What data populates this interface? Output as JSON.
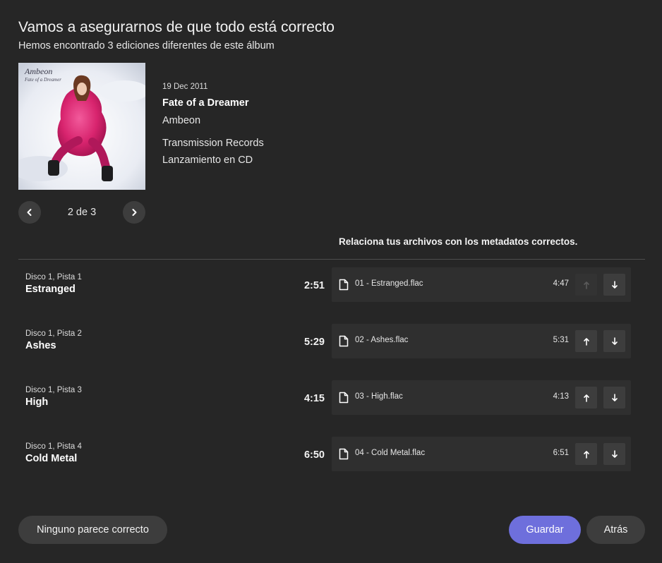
{
  "header": {
    "title": "Vamos a asegurarnos de que todo está correcto",
    "subtitle": "Hemos encontrado 3 ediciones diferentes de este álbum"
  },
  "edition": {
    "cover_text_artist": "Ambeon",
    "cover_text_album": "Fate of a Dreamer",
    "date": "19 Dec 2011",
    "album": "Fate of a Dreamer",
    "artist": "Ambeon",
    "label": "Transmission Records",
    "format": "Lanzamiento en CD"
  },
  "pager": {
    "label": "2 de 3",
    "prev_icon": "chevron-left-icon",
    "next_icon": "chevron-right-icon"
  },
  "instruction": "Relaciona tus archivos con los metadatos correctos.",
  "tracks": [
    {
      "position": "Disco 1, Pista 1",
      "title": "Estranged",
      "duration": "2:51",
      "file": "01 - Estranged.flac",
      "file_duration": "4:47",
      "up_enabled": false
    },
    {
      "position": "Disco 1, Pista 2",
      "title": "Ashes",
      "duration": "5:29",
      "file": "02 - Ashes.flac",
      "file_duration": "5:31",
      "up_enabled": true
    },
    {
      "position": "Disco 1, Pista 3",
      "title": "High",
      "duration": "4:15",
      "file": "03 - High.flac",
      "file_duration": "4:13",
      "up_enabled": true
    },
    {
      "position": "Disco 1, Pista 4",
      "title": "Cold Metal",
      "duration": "6:50",
      "file": "04 - Cold Metal.flac",
      "file_duration": "6:51",
      "up_enabled": true
    }
  ],
  "buttons": {
    "none": "Ninguno parece correcto",
    "save": "Guardar",
    "back": "Atrás"
  },
  "colors": {
    "background": "#262626",
    "surface": "#2f2f2f",
    "button": "#3d3d3d",
    "accent": "#6e6fdc"
  }
}
